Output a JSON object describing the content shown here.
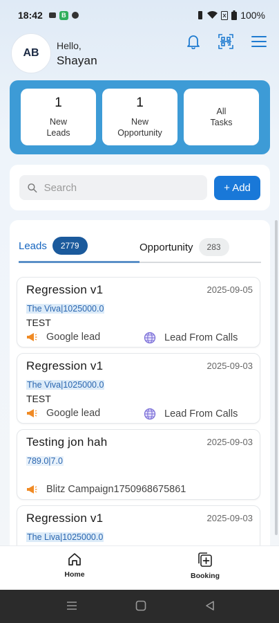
{
  "status_bar": {
    "time": "18:42",
    "battery": "100%"
  },
  "header": {
    "avatar_initials": "AB",
    "greeting": "Hello,",
    "user_name": "Shayan",
    "icons": [
      "bell-icon",
      "qr-scan-icon",
      "menu-icon"
    ]
  },
  "stats": [
    {
      "value": "1",
      "label": "New\nLeads"
    },
    {
      "value": "1",
      "label": "New\nOpportunity"
    },
    {
      "value": "",
      "label": "All\nTasks"
    }
  ],
  "search": {
    "placeholder": "Search",
    "add_label": "+ Add"
  },
  "tabs": {
    "leads_label": "Leads",
    "leads_count": "2779",
    "opportunity_label": "Opportunity",
    "opportunity_count": "283"
  },
  "leads": [
    {
      "title": "Regression v1",
      "date": "2025-09-05",
      "project": "The Viva|1025000.0",
      "note": "TEST",
      "source": "Google lead",
      "channel": "Lead From Calls"
    },
    {
      "title": "Regression v1",
      "date": "2025-09-03",
      "project": "The Viva|1025000.0",
      "note": "TEST",
      "source": "Google lead",
      "channel": "Lead From Calls"
    },
    {
      "title": "Testing jon hah",
      "date": "2025-09-03",
      "project": "789.0|7.0",
      "note": "",
      "source": "Blitz Campaign1750968675861",
      "channel": ""
    },
    {
      "title": "Regression v1",
      "date": "2025-09-03",
      "project": "The Liva|1025000.0",
      "note": "",
      "source": "",
      "channel": ""
    }
  ],
  "bottom_nav": {
    "home_label": "Home",
    "booking_label": "Booking"
  },
  "colors": {
    "accent_blue": "#3d9bd6",
    "button_blue": "#1978d8",
    "active_tab": "#1565c0",
    "pill_dark": "#1b5a9c",
    "megaphone": "#f08a24",
    "globe": "#7b6fd8"
  }
}
